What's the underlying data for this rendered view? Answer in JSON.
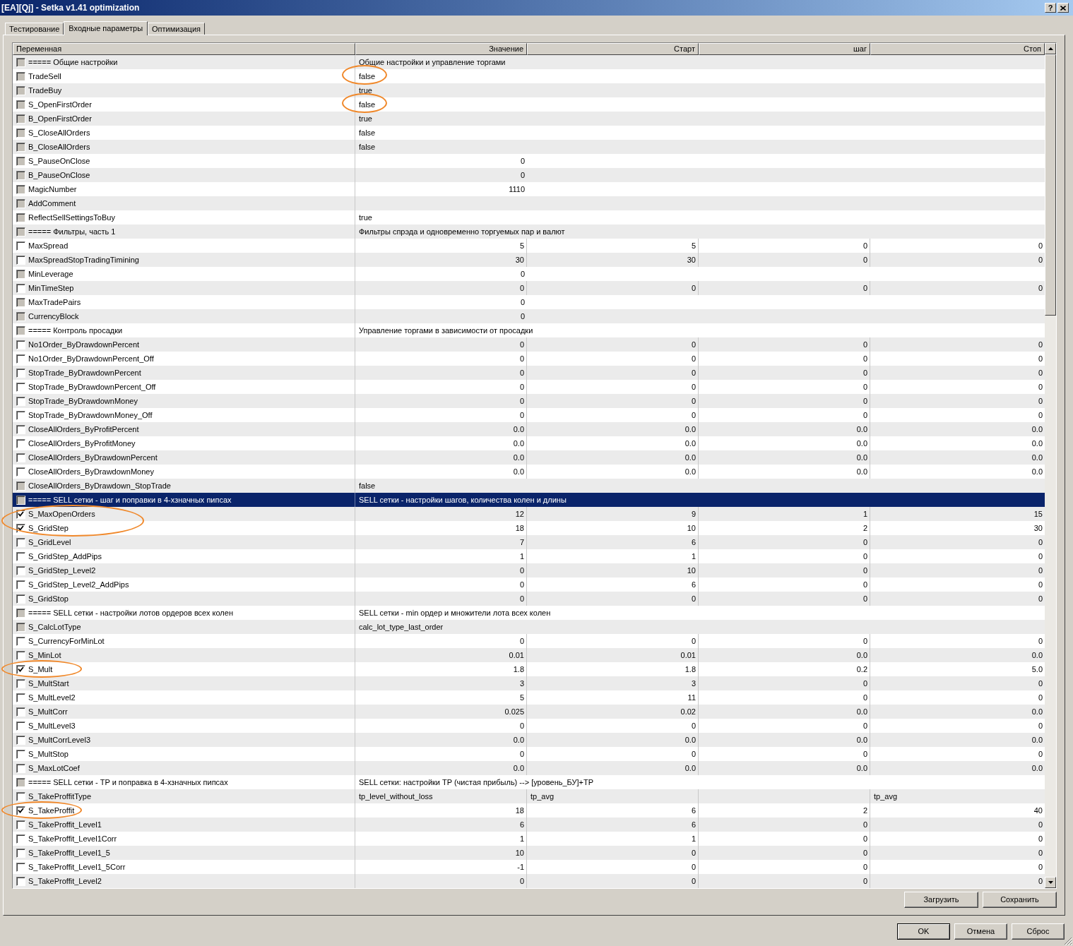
{
  "window": {
    "title": "[EA][Qj] - Setka v1.41 optimization",
    "help_label": "?"
  },
  "tabs": [
    {
      "label": "Тестирование",
      "selected": false
    },
    {
      "label": "Входные параметры",
      "selected": true
    },
    {
      "label": "Оптимизация",
      "selected": false
    }
  ],
  "table": {
    "columns": [
      "Переменная",
      "Значение",
      "Старт",
      "шаг",
      "Стоп"
    ],
    "rows": [
      {
        "kind": "section",
        "name": "===== Общие настройки",
        "value": "Общие настройки и управление торгами",
        "checked": false,
        "disabled": true,
        "selected": false,
        "name_circled": false,
        "value_circled": false
      },
      {
        "kind": "text",
        "name": "TradeSell",
        "value": "false",
        "checked": false,
        "disabled": true,
        "selected": false,
        "name_circled": false,
        "value_circled": true
      },
      {
        "kind": "text",
        "name": "TradeBuy",
        "value": "true",
        "checked": false,
        "disabled": true,
        "selected": false,
        "name_circled": false,
        "value_circled": false
      },
      {
        "kind": "text",
        "name": "S_OpenFirstOrder",
        "value": "false",
        "checked": false,
        "disabled": true,
        "selected": false,
        "name_circled": false,
        "value_circled": true
      },
      {
        "kind": "text",
        "name": "B_OpenFirstOrder",
        "value": "true",
        "checked": false,
        "disabled": true,
        "selected": false,
        "name_circled": false,
        "value_circled": false
      },
      {
        "kind": "text",
        "name": "S_CloseAllOrders",
        "value": "false",
        "checked": false,
        "disabled": true,
        "selected": false,
        "name_circled": false,
        "value_circled": false
      },
      {
        "kind": "text",
        "name": "B_CloseAllOrders",
        "value": "false",
        "checked": false,
        "disabled": true,
        "selected": false,
        "name_circled": false,
        "value_circled": false
      },
      {
        "kind": "number",
        "name": "S_PauseOnClose",
        "value": "0",
        "checked": false,
        "disabled": true,
        "selected": false,
        "name_circled": false,
        "value_circled": false
      },
      {
        "kind": "number",
        "name": "B_PauseOnClose",
        "value": "0",
        "checked": false,
        "disabled": true,
        "selected": false,
        "name_circled": false,
        "value_circled": false
      },
      {
        "kind": "number",
        "name": "MagicNumber",
        "value": "1110",
        "checked": false,
        "disabled": true,
        "selected": false,
        "name_circled": false,
        "value_circled": false
      },
      {
        "kind": "text",
        "name": "AddComment",
        "checked": false,
        "disabled": true,
        "selected": false,
        "name_circled": false,
        "value_circled": false
      },
      {
        "kind": "text",
        "name": "ReflectSellSettingsToBuy",
        "value": "true",
        "checked": false,
        "disabled": true,
        "selected": false,
        "name_circled": false,
        "value_circled": false
      },
      {
        "kind": "section",
        "name": "===== Фильтры, часть 1",
        "value": "Фильтры спрэда и одновременно торгуемых пар и валют",
        "checked": false,
        "disabled": true,
        "selected": false,
        "name_circled": false,
        "value_circled": false
      },
      {
        "kind": "number",
        "name": "MaxSpread",
        "value": "5",
        "start": "5",
        "step": "0",
        "stop": "0",
        "checked": false,
        "disabled": false,
        "selected": false,
        "name_circled": false,
        "value_circled": false
      },
      {
        "kind": "number",
        "name": "MaxSpreadStopTradingTimining",
        "value": "30",
        "start": "30",
        "step": "0",
        "stop": "0",
        "checked": false,
        "disabled": false,
        "selected": false,
        "name_circled": false,
        "value_circled": false
      },
      {
        "kind": "number",
        "name": "MinLeverage",
        "value": "0",
        "checked": false,
        "disabled": true,
        "selected": false,
        "name_circled": false,
        "value_circled": false
      },
      {
        "kind": "number",
        "name": "MinTimeStep",
        "value": "0",
        "start": "0",
        "step": "0",
        "stop": "0",
        "checked": false,
        "disabled": false,
        "selected": false,
        "name_circled": false,
        "value_circled": false
      },
      {
        "kind": "number",
        "name": "MaxTradePairs",
        "value": "0",
        "checked": false,
        "disabled": true,
        "selected": false,
        "name_circled": false,
        "value_circled": false
      },
      {
        "kind": "number",
        "name": "CurrencyBlock",
        "value": "0",
        "checked": false,
        "disabled": true,
        "selected": false,
        "name_circled": false,
        "value_circled": false
      },
      {
        "kind": "section",
        "name": "===== Контроль просадки",
        "value": "Управление торгами в зависимости от просадки",
        "checked": false,
        "disabled": true,
        "selected": false,
        "name_circled": false,
        "value_circled": false
      },
      {
        "kind": "number",
        "name": "No1Order_ByDrawdownPercent",
        "value": "0",
        "start": "0",
        "step": "0",
        "stop": "0",
        "checked": false,
        "disabled": false,
        "selected": false,
        "name_circled": false,
        "value_circled": false
      },
      {
        "kind": "number",
        "name": "No1Order_ByDrawdownPercent_Off",
        "value": "0",
        "start": "0",
        "step": "0",
        "stop": "0",
        "checked": false,
        "disabled": false,
        "selected": false,
        "name_circled": false,
        "value_circled": false
      },
      {
        "kind": "number",
        "name": "StopTrade_ByDrawdownPercent",
        "value": "0",
        "start": "0",
        "step": "0",
        "stop": "0",
        "checked": false,
        "disabled": false,
        "selected": false,
        "name_circled": false,
        "value_circled": false
      },
      {
        "kind": "number",
        "name": "StopTrade_ByDrawdownPercent_Off",
        "value": "0",
        "start": "0",
        "step": "0",
        "stop": "0",
        "checked": false,
        "disabled": false,
        "selected": false,
        "name_circled": false,
        "value_circled": false
      },
      {
        "kind": "number",
        "name": "StopTrade_ByDrawdownMoney",
        "value": "0",
        "start": "0",
        "step": "0",
        "stop": "0",
        "checked": false,
        "disabled": false,
        "selected": false,
        "name_circled": false,
        "value_circled": false
      },
      {
        "kind": "number",
        "name": "StopTrade_ByDrawdownMoney_Off",
        "value": "0",
        "start": "0",
        "step": "0",
        "stop": "0",
        "checked": false,
        "disabled": false,
        "selected": false,
        "name_circled": false,
        "value_circled": false
      },
      {
        "kind": "number",
        "name": "CloseAllOrders_ByProfitPercent",
        "value": "0.0",
        "start": "0.0",
        "step": "0.0",
        "stop": "0.0",
        "checked": false,
        "disabled": false,
        "selected": false,
        "name_circled": false,
        "value_circled": false
      },
      {
        "kind": "number",
        "name": "CloseAllOrders_ByProfitMoney",
        "value": "0.0",
        "start": "0.0",
        "step": "0.0",
        "stop": "0.0",
        "checked": false,
        "disabled": false,
        "selected": false,
        "name_circled": false,
        "value_circled": false
      },
      {
        "kind": "number",
        "name": "CloseAllOrders_ByDrawdownPercent",
        "value": "0.0",
        "start": "0.0",
        "step": "0.0",
        "stop": "0.0",
        "checked": false,
        "disabled": false,
        "selected": false,
        "name_circled": false,
        "value_circled": false
      },
      {
        "kind": "number",
        "name": "CloseAllOrders_ByDrawdownMoney",
        "value": "0.0",
        "start": "0.0",
        "step": "0.0",
        "stop": "0.0",
        "checked": false,
        "disabled": false,
        "selected": false,
        "name_circled": false,
        "value_circled": false
      },
      {
        "kind": "text",
        "name": "CloseAllOrders_ByDrawdown_StopTrade",
        "value": "false",
        "checked": false,
        "disabled": true,
        "selected": false,
        "name_circled": false,
        "value_circled": false
      },
      {
        "kind": "section",
        "name": "===== SELL сетки - шаг и поправки в 4-хзначных пипсах",
        "value": "SELL сетки - настройки шагов, количества колен и длины",
        "checked": false,
        "disabled": true,
        "selected": true,
        "name_circled": false,
        "value_circled": false
      },
      {
        "kind": "number",
        "name": "S_MaxOpenOrders",
        "value": "12",
        "start": "9",
        "step": "1",
        "stop": "15",
        "checked": true,
        "disabled": false,
        "selected": false,
        "name_circled": true,
        "value_circled": false
      },
      {
        "kind": "number",
        "name": "S_GridStep",
        "value": "18",
        "start": "10",
        "step": "2",
        "stop": "30",
        "checked": true,
        "disabled": false,
        "selected": false,
        "name_circled": true,
        "value_circled": false
      },
      {
        "kind": "number",
        "name": "S_GridLevel",
        "value": "7",
        "start": "6",
        "step": "0",
        "stop": "0",
        "checked": false,
        "disabled": false,
        "selected": false,
        "name_circled": false,
        "value_circled": false
      },
      {
        "kind": "number",
        "name": "S_GridStep_AddPips",
        "value": "1",
        "start": "1",
        "step": "0",
        "stop": "0",
        "checked": false,
        "disabled": false,
        "selected": false,
        "name_circled": false,
        "value_circled": false
      },
      {
        "kind": "number",
        "name": "S_GridStep_Level2",
        "value": "0",
        "start": "10",
        "step": "0",
        "stop": "0",
        "checked": false,
        "disabled": false,
        "selected": false,
        "name_circled": false,
        "value_circled": false
      },
      {
        "kind": "number",
        "name": "S_GridStep_Level2_AddPips",
        "value": "0",
        "start": "6",
        "step": "0",
        "stop": "0",
        "checked": false,
        "disabled": false,
        "selected": false,
        "name_circled": false,
        "value_circled": false
      },
      {
        "kind": "number",
        "name": "S_GridStop",
        "value": "0",
        "start": "0",
        "step": "0",
        "stop": "0",
        "checked": false,
        "disabled": false,
        "selected": false,
        "name_circled": false,
        "value_circled": false
      },
      {
        "kind": "section",
        "name": "===== SELL сетки - настройки лотов ордеров всех колен",
        "value": "SELL сетки - min ордер и множители лота всех колен",
        "checked": false,
        "disabled": true,
        "selected": false,
        "name_circled": false,
        "value_circled": false
      },
      {
        "kind": "text",
        "name": "S_CalcLotType",
        "value": "calc_lot_type_last_order",
        "checked": false,
        "disabled": true,
        "selected": false,
        "name_circled": false,
        "value_circled": false
      },
      {
        "kind": "number",
        "name": "S_CurrencyForMinLot",
        "value": "0",
        "start": "0",
        "step": "0",
        "stop": "0",
        "checked": false,
        "disabled": false,
        "selected": false,
        "name_circled": false,
        "value_circled": false
      },
      {
        "kind": "number",
        "name": "S_MinLot",
        "value": "0.01",
        "start": "0.01",
        "step": "0.0",
        "stop": "0.0",
        "checked": false,
        "disabled": false,
        "selected": false,
        "name_circled": false,
        "value_circled": false
      },
      {
        "kind": "number",
        "name": "S_Mult",
        "value": "1.8",
        "start": "1.8",
        "step": "0.2",
        "stop": "5.0",
        "checked": true,
        "disabled": false,
        "selected": false,
        "name_circled": true,
        "value_circled": false
      },
      {
        "kind": "number",
        "name": "S_MultStart",
        "value": "3",
        "start": "3",
        "step": "0",
        "stop": "0",
        "checked": false,
        "disabled": false,
        "selected": false,
        "name_circled": false,
        "value_circled": false
      },
      {
        "kind": "number",
        "name": "S_MultLevel2",
        "value": "5",
        "start": "11",
        "step": "0",
        "stop": "0",
        "checked": false,
        "disabled": false,
        "selected": false,
        "name_circled": false,
        "value_circled": false
      },
      {
        "kind": "number",
        "name": "S_MultCorr",
        "value": "0.025",
        "start": "0.02",
        "step": "0.0",
        "stop": "0.0",
        "checked": false,
        "disabled": false,
        "selected": false,
        "name_circled": false,
        "value_circled": false
      },
      {
        "kind": "number",
        "name": "S_MultLevel3",
        "value": "0",
        "start": "0",
        "step": "0",
        "stop": "0",
        "checked": false,
        "disabled": false,
        "selected": false,
        "name_circled": false,
        "value_circled": false
      },
      {
        "kind": "number",
        "name": "S_MultCorrLevel3",
        "value": "0.0",
        "start": "0.0",
        "step": "0.0",
        "stop": "0.0",
        "checked": false,
        "disabled": false,
        "selected": false,
        "name_circled": false,
        "value_circled": false
      },
      {
        "kind": "number",
        "name": "S_MultStop",
        "value": "0",
        "start": "0",
        "step": "0",
        "stop": "0",
        "checked": false,
        "disabled": false,
        "selected": false,
        "name_circled": false,
        "value_circled": false
      },
      {
        "kind": "number",
        "name": "S_MaxLotCoef",
        "value": "0.0",
        "start": "0.0",
        "step": "0.0",
        "stop": "0.0",
        "checked": false,
        "disabled": false,
        "selected": false,
        "name_circled": false,
        "value_circled": false
      },
      {
        "kind": "section",
        "name": "===== SELL сетки - TP и поправка в 4-хзначных пипсах",
        "value": "SELL сетки: настройки TP (чистая прибыль) --> [уровень_БУ]+TP",
        "checked": false,
        "disabled": true,
        "selected": false,
        "name_circled": false,
        "value_circled": false
      },
      {
        "kind": "text",
        "name": "S_TakeProffitType",
        "value": "tp_level_without_loss",
        "start_option": "tp_avg",
        "stop_option": "tp_avg",
        "checked": false,
        "disabled": false,
        "selected": false,
        "name_circled": false,
        "value_circled": false
      },
      {
        "kind": "number",
        "name": "S_TakeProffit",
        "value": "18",
        "start": "6",
        "step": "2",
        "stop": "40",
        "checked": true,
        "disabled": false,
        "selected": false,
        "name_circled": true,
        "value_circled": false
      },
      {
        "kind": "number",
        "name": "S_TakeProffit_Level1",
        "value": "6",
        "start": "6",
        "step": "0",
        "stop": "0",
        "checked": false,
        "disabled": false,
        "selected": false,
        "name_circled": false,
        "value_circled": false
      },
      {
        "kind": "number",
        "name": "S_TakeProffit_Level1Corr",
        "value": "1",
        "start": "1",
        "step": "0",
        "stop": "0",
        "checked": false,
        "disabled": false,
        "selected": false,
        "name_circled": false,
        "value_circled": false
      },
      {
        "kind": "number",
        "name": "S_TakeProffit_Level1_5",
        "value": "10",
        "start": "0",
        "step": "0",
        "stop": "0",
        "checked": false,
        "disabled": false,
        "selected": false,
        "name_circled": false,
        "value_circled": false
      },
      {
        "kind": "number",
        "name": "S_TakeProffit_Level1_5Corr",
        "value": "-1",
        "start": "0",
        "step": "0",
        "stop": "0",
        "checked": false,
        "disabled": false,
        "selected": false,
        "name_circled": false,
        "value_circled": false
      },
      {
        "kind": "number",
        "name": "S_TakeProffit_Level2",
        "value": "0",
        "start": "0",
        "step": "0",
        "stop": "0",
        "checked": false,
        "disabled": false,
        "selected": false,
        "name_circled": false,
        "value_circled": false
      }
    ]
  },
  "panel_buttons": [
    "Загрузить",
    "Сохранить"
  ],
  "buttons": [
    {
      "label": "OK",
      "default": true
    },
    {
      "label": "Отмена",
      "default": false
    },
    {
      "label": "Сброс",
      "default": false
    }
  ]
}
